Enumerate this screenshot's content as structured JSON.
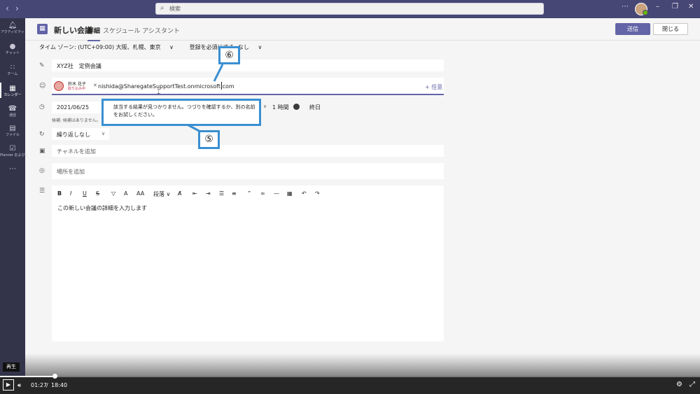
{
  "search": {
    "placeholder": "検索"
  },
  "rail": [
    {
      "label": "アクティビティ",
      "icon": "bell-icon"
    },
    {
      "label": "チャット",
      "icon": "chat-icon"
    },
    {
      "label": "チーム",
      "icon": "teams-icon"
    },
    {
      "label": "カレンダー",
      "icon": "calendar-icon",
      "active": true
    },
    {
      "label": "通話",
      "icon": "phone-icon"
    },
    {
      "label": "ファイル",
      "icon": "file-icon"
    },
    {
      "label": "Planner および...",
      "icon": "planner-icon"
    }
  ],
  "header": {
    "title": "新しい会議",
    "tabs": [
      "詳細",
      "スケジュール アシスタント"
    ],
    "send": "送信",
    "close": "閉じる"
  },
  "options": {
    "timezone": "タイム ゾーン: (UTC+09:00) 大阪、札幌、東京",
    "registration": "登録を必須にする: なし"
  },
  "form": {
    "title": "XYZ社　定例会議",
    "attendee": {
      "name": "鈴木 花子",
      "status": "取り込み中"
    },
    "typed_email": "nishida@SharegateSupportTest.onmicrosoft.com",
    "optional": "+ 任意",
    "date": "2021/06/25",
    "duration": "1 時間",
    "allday": "終日",
    "suggestion": "候補: 候補はありません。",
    "repeat": "繰り返しなし",
    "channel": "チャネルを追加",
    "location": "場所を追加",
    "paragraph": "段落",
    "details": "この新しい会議の詳細を入力します"
  },
  "annotations": {
    "callout6": "⑥",
    "callout5": "⑤",
    "balloon": "該当する結果が見つかりません。つづりを確認するか、別の名前をお試しください。"
  },
  "video": {
    "tooltip": "再生",
    "current": "01:27",
    "separator": "/",
    "total": "18:40",
    "progress_fraction": 0.078
  }
}
